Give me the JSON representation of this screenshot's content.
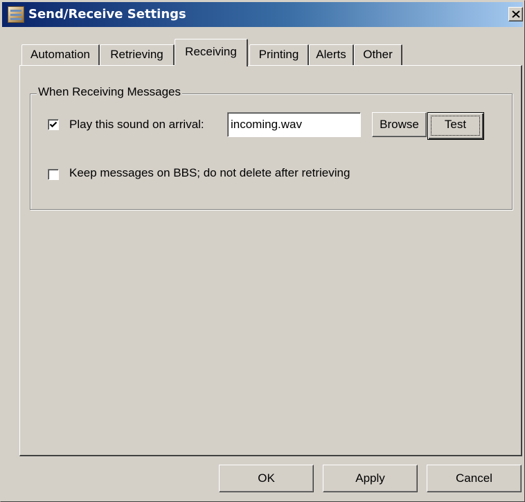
{
  "window": {
    "title": "Send/Receive Settings",
    "close_label": "×"
  },
  "tabs": [
    {
      "label": "Automation",
      "selected": false
    },
    {
      "label": "Retrieving",
      "selected": false
    },
    {
      "label": "Receiving",
      "selected": true
    },
    {
      "label": "Printing",
      "selected": false
    },
    {
      "label": "Alerts",
      "selected": false
    },
    {
      "label": "Other",
      "selected": false
    }
  ],
  "group": {
    "title": "When Receiving Messages",
    "play_sound": {
      "checked": true,
      "label": "Play this sound on arrival:",
      "sound_file": "incoming.wav"
    },
    "browse_label": "Browse",
    "test_label": "Test",
    "keep_messages": {
      "checked": false,
      "label": "Keep messages on BBS; do not delete after retrieving"
    }
  },
  "footer": {
    "ok_label": "OK",
    "apply_label": "Apply",
    "cancel_label": "Cancel"
  },
  "colors": {
    "face": "#d4d0c8",
    "title_start": "#0a246a",
    "title_end": "#a6caf0"
  }
}
